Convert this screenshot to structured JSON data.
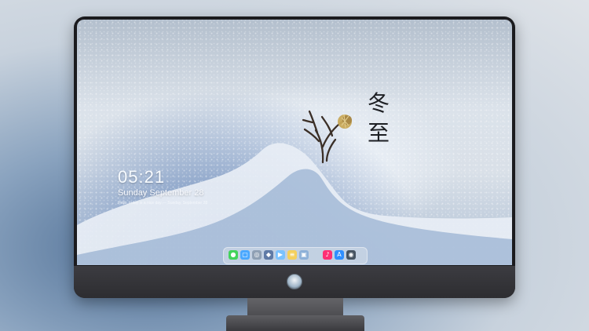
{
  "clock": {
    "time": "05:21",
    "date": "Sunday September  28"
  },
  "wallpaper": {
    "chars": [
      "冬",
      "至"
    ],
    "info_line": "Hello, today is a nice day — Sunday, September 28"
  },
  "dock_items": [
    {
      "name": "messages-icon",
      "color": "#43d35b",
      "glyph": "●"
    },
    {
      "name": "finder-icon",
      "color": "#4aa8ff",
      "glyph": "▢"
    },
    {
      "name": "safari-icon",
      "color": "#8fa0b4",
      "glyph": "◎"
    },
    {
      "name": "photos-icon",
      "color": "#5f7aa6",
      "glyph": "◆"
    },
    {
      "name": "video-icon",
      "color": "#7bc2ff",
      "glyph": "▶"
    },
    {
      "name": "notes-icon",
      "color": "#f4d05d",
      "glyph": "≡"
    },
    {
      "name": "preview-icon",
      "color": "#8eb1d8",
      "glyph": "▣"
    },
    {
      "name": "music-icon",
      "color": "#ff2f75",
      "glyph": "♪"
    },
    {
      "name": "appstore-icon",
      "color": "#2f8fff",
      "glyph": "A"
    },
    {
      "name": "camera-icon",
      "color": "#475462",
      "glyph": "◉"
    }
  ]
}
